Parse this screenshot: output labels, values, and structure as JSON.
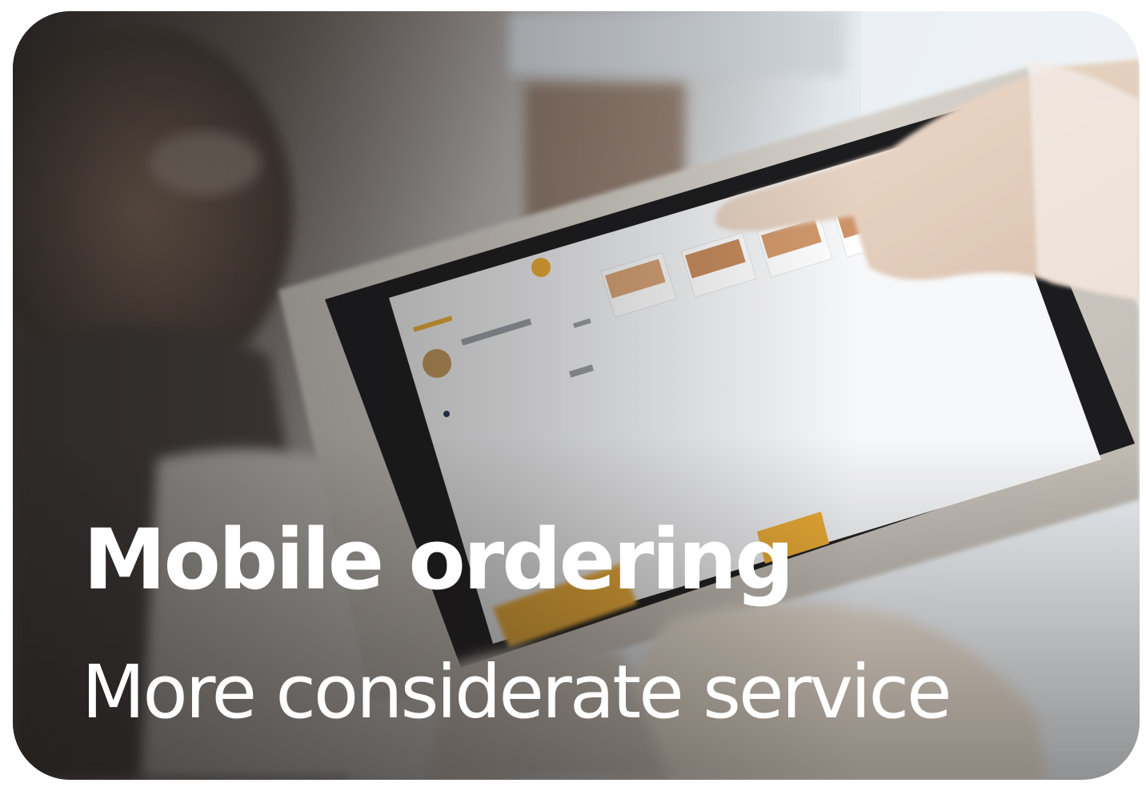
{
  "hero": {
    "title": "Mobile ordering",
    "subtitle": "More considerate service"
  },
  "colors": {
    "text": "#ffffff",
    "tablet_screen": "#f7f8fa",
    "tablet_frame": "#d7d3cd",
    "accent": "#f2b035"
  }
}
